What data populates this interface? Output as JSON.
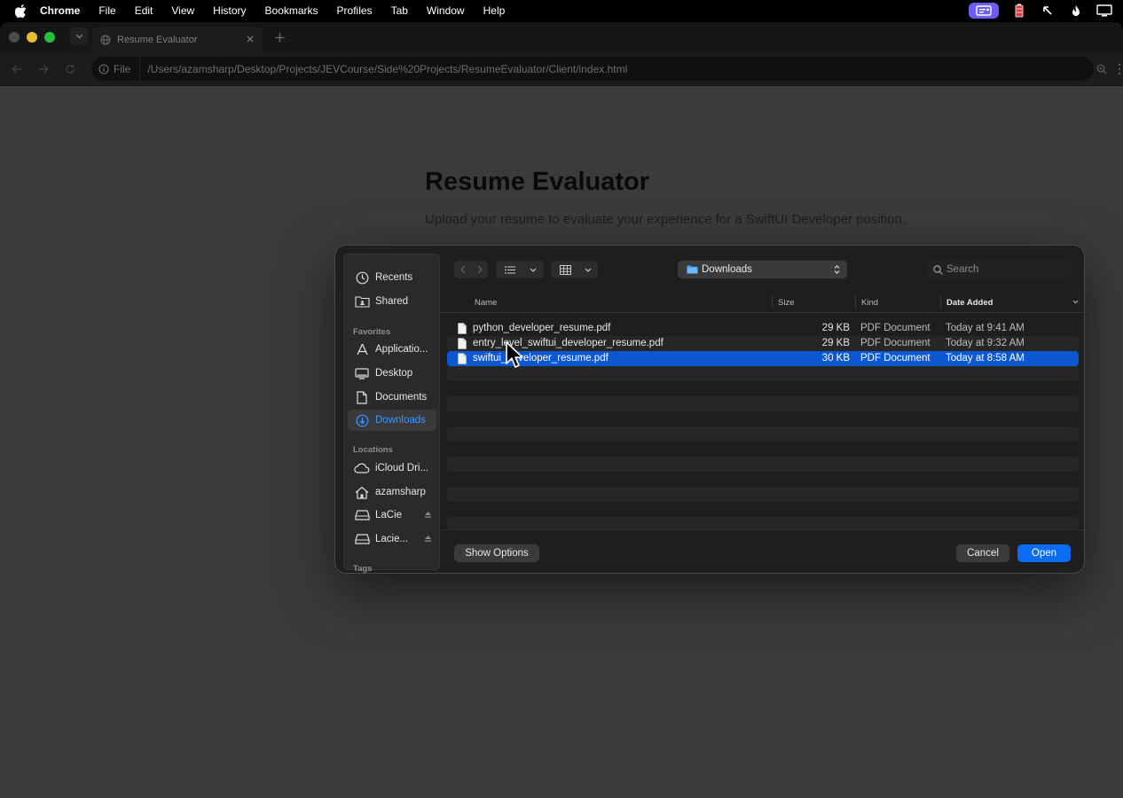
{
  "menubar": {
    "app": "Chrome",
    "items": [
      "File",
      "Edit",
      "View",
      "History",
      "Bookmarks",
      "Profiles",
      "Tab",
      "Window",
      "Help"
    ],
    "status_icons": [
      "screen-share-icon",
      "battery-icon",
      "arrow-up-left-icon",
      "flame-icon",
      "display-icon"
    ]
  },
  "browser": {
    "tab_title": "Resume Evaluator",
    "omnibox_chip": "File",
    "url": "/Users/azamsharp/Desktop/Projects/JEVCourse/Side%20Projects/ResumeEvaluator/Client/index.html"
  },
  "page": {
    "title": "Resume Evaluator",
    "subtitle": "Upload your resume to evaluate your experience for a SwiftUI Developer position."
  },
  "dialog": {
    "sidebar": {
      "recents": "Recents",
      "shared": "Shared",
      "favorites_header": "Favorites",
      "applications": "Applicatio...",
      "desktop": "Desktop",
      "documents": "Documents",
      "downloads": "Downloads",
      "locations_header": "Locations",
      "icloud": "iCloud Dri...",
      "home": "azamsharp",
      "lacie": "LaCie",
      "lacie2": "Lacie...",
      "tags_header": "Tags"
    },
    "location": "Downloads",
    "search_placeholder": "Search",
    "columns": {
      "name": "Name",
      "size": "Size",
      "kind": "Kind",
      "date_added": "Date Added"
    },
    "files": [
      {
        "name": "python_developer_resume.pdf",
        "size": "29 KB",
        "kind": "PDF Document",
        "date": "Today at 9:41 AM"
      },
      {
        "name": "entry_level_swiftui_developer_resume.pdf",
        "size": "29 KB",
        "kind": "PDF Document",
        "date": "Today at 9:32 AM"
      },
      {
        "name": "swiftui_developer_resume.pdf",
        "size": "30 KB",
        "kind": "PDF Document",
        "date": "Today at 8:58 AM"
      }
    ],
    "selected_index": 2,
    "show_options": "Show Options",
    "cancel": "Cancel",
    "open": "Open"
  },
  "colors": {
    "accent": "#0a6cf5",
    "selection": "#0d58d1",
    "sidebar_active_text": "#3f95ff"
  }
}
